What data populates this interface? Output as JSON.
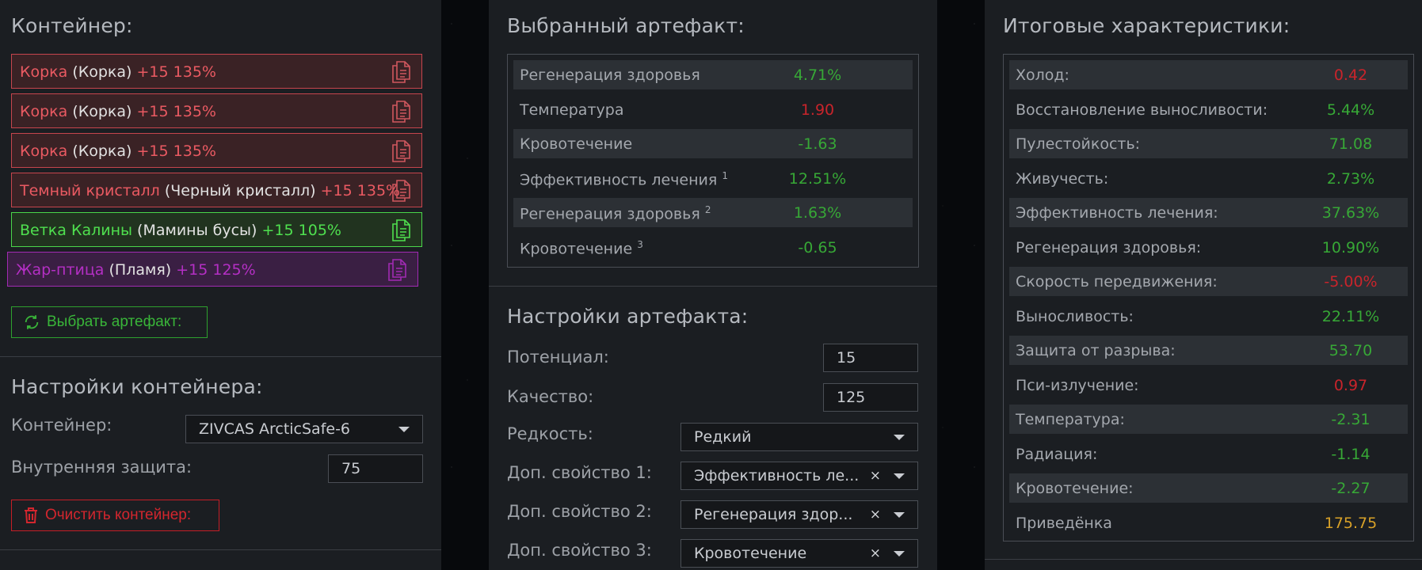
{
  "colors": {
    "positive": "#37a836",
    "negative": "#c9242b",
    "special": "#d8a128",
    "slot_red": "#ea5a62",
    "slot_green": "#4fe04f",
    "slot_purple": "#b42fc4"
  },
  "left": {
    "title": "Контейнер:",
    "slots": [
      {
        "name": "Корка",
        "base": "(Корка)",
        "level": "+15 135%",
        "style": "red",
        "icon": "copy-icon"
      },
      {
        "name": "Корка",
        "base": "(Корка)",
        "level": "+15 135%",
        "style": "red",
        "icon": "copy-icon"
      },
      {
        "name": "Корка",
        "base": "(Корка)",
        "level": "+15 135%",
        "style": "red",
        "icon": "copy-icon"
      },
      {
        "name": "Темный кристалл",
        "base": "(Черный кристалл)",
        "level": "+15 135%",
        "style": "red",
        "icon": "copy-icon"
      },
      {
        "name": "Ветка Калины",
        "base": "(Мамины бусы)",
        "level": "+15 105%",
        "style": "green",
        "icon": "copy-icon"
      },
      {
        "name": "Жар-птица",
        "base": "(Пламя)",
        "level": "+15 125%",
        "style": "purple",
        "icon": "copy-icon"
      }
    ],
    "select_button": "Выбрать артефакт:",
    "settings_title": "Настройки контейнера:",
    "container_label": "Контейнер:",
    "container_value": "ZIVCAS ArcticSafe-6",
    "protection_label": "Внутренняя защита:",
    "protection_value": "75",
    "clear_button": "Очистить контейнер:"
  },
  "mid": {
    "title": "Выбранный артефакт:",
    "stats": [
      {
        "label": "Регенерация здоровья",
        "sup": "",
        "value": "4.71%",
        "tone": "g"
      },
      {
        "label": "Температура",
        "sup": "",
        "value": "1.90",
        "tone": "r"
      },
      {
        "label": "Кровотечение",
        "sup": "",
        "value": "-1.63",
        "tone": "g"
      },
      {
        "label": "Эффективность лечения",
        "sup": "1",
        "value": "12.51%",
        "tone": "g"
      },
      {
        "label": "Регенерация здоровья",
        "sup": "2",
        "value": "1.63%",
        "tone": "g"
      },
      {
        "label": "Кровотечение",
        "sup": "3",
        "value": "-0.65",
        "tone": "g"
      }
    ],
    "settings_title": "Настройки артефакта:",
    "potential_label": "Потенциал:",
    "potential_value": "15",
    "quality_label": "Качество:",
    "quality_value": "125",
    "rarity_label": "Редкость:",
    "rarity_value": "Редкий",
    "extra1_label": "Доп. свойство 1:",
    "extra1_value": "Эффективность ле...",
    "extra2_label": "Доп. свойство 2:",
    "extra2_value": "Регенерация здор...",
    "extra3_label": "Доп. свойство 3:",
    "extra3_value": "Кровотечение",
    "clear_glyph": "×"
  },
  "right": {
    "title": "Итоговые характеристики:",
    "stats": [
      {
        "label": "Холод:",
        "value": "0.42",
        "tone": "r"
      },
      {
        "label": "Восстановление выносливости:",
        "value": "5.44%",
        "tone": "g"
      },
      {
        "label": "Пулестойкость:",
        "value": "71.08",
        "tone": "g"
      },
      {
        "label": "Живучесть:",
        "value": "2.73%",
        "tone": "g"
      },
      {
        "label": "Эффективность лечения:",
        "value": "37.63%",
        "tone": "g"
      },
      {
        "label": "Регенерация здоровья:",
        "value": "10.90%",
        "tone": "g"
      },
      {
        "label": "Скорость передвижения:",
        "value": "-5.00%",
        "tone": "r"
      },
      {
        "label": "Выносливость:",
        "value": "22.11%",
        "tone": "g"
      },
      {
        "label": "Защита от разрыва:",
        "value": "53.70",
        "tone": "g"
      },
      {
        "label": "Пси-излучение:",
        "value": "0.97",
        "tone": "r"
      },
      {
        "label": "Температура:",
        "value": "-2.31",
        "tone": "g"
      },
      {
        "label": "Радиация:",
        "value": "-1.14",
        "tone": "g"
      },
      {
        "label": "Кровотечение:",
        "value": "-2.27",
        "tone": "g"
      },
      {
        "label": "Приведёнка",
        "value": "175.75",
        "tone": "y"
      }
    ]
  }
}
